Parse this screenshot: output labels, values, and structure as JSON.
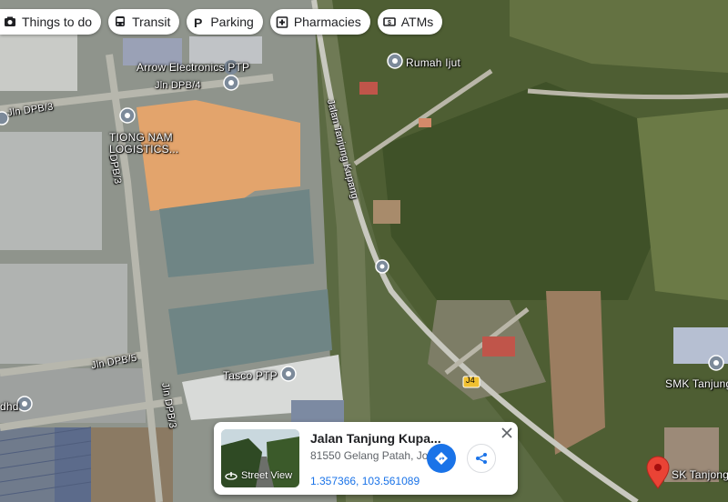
{
  "chips": [
    {
      "label": "Things to do",
      "icon": "camera-icon"
    },
    {
      "label": "Transit",
      "icon": "bus-icon"
    },
    {
      "label": "Parking",
      "icon": "parking-icon"
    },
    {
      "label": "Pharmacies",
      "icon": "pharmacy-icon"
    },
    {
      "label": "ATMs",
      "icon": "atm-icon"
    }
  ],
  "places": {
    "arrow": "Arrow Electronics PTP",
    "jln_dpb4": "Jln DPB/4",
    "jln_dpb3_top": "Jln DPB/3",
    "tiong_nam_1": "TIONG NAM",
    "tiong_nam_2": "LOGISTICS...",
    "dpb3_vertical": "DPB/3",
    "jalan_tanjung_kupang": "Jalan Tanjung Kupang",
    "rumah_ijut": "Rumah Ijut",
    "jln_dpb5": "Jln DPB/5",
    "tasco": "Tasco PTP",
    "jln_dpb3_vertical": "Jln DPB/3",
    "bhd": "dhd",
    "j4": "J4",
    "smk": "SMK Tanjung",
    "sk": "SK Tanjong"
  },
  "card": {
    "title": "Jalan Tanjung Kupa...",
    "address": "81550 Gelang Patah, Jo...",
    "coords": "1.357366, 103.561089",
    "street_view": "Street View"
  },
  "colors": {
    "accent": "#1a73e8",
    "pin_red": "#ea4335",
    "marker_gray": "#7c8a9a"
  }
}
